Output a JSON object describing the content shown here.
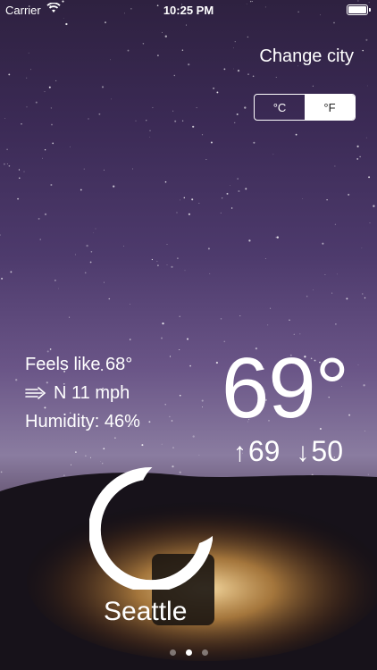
{
  "status_bar": {
    "carrier": "Carrier",
    "time": "10:25 PM"
  },
  "header": {
    "change_city_label": "Change city"
  },
  "unit_toggle": {
    "celsius_label": "°C",
    "fahrenheit_label": "°F",
    "selected": "°F"
  },
  "weather": {
    "feels_like": "Feels like 68°",
    "wind": "N 11 mph",
    "humidity": "Humidity: 46%",
    "temperature": "69°",
    "high": "69",
    "low": "50",
    "condition_icon": "moon-icon",
    "city": "Seattle"
  },
  "pager": {
    "pages": 3,
    "active_index": 1
  },
  "icons": {
    "wifi": "wifi-icon",
    "battery": "battery-icon",
    "wind": "wind-icon",
    "high_arrow": "arrow-up-icon",
    "low_arrow": "arrow-down-icon"
  }
}
